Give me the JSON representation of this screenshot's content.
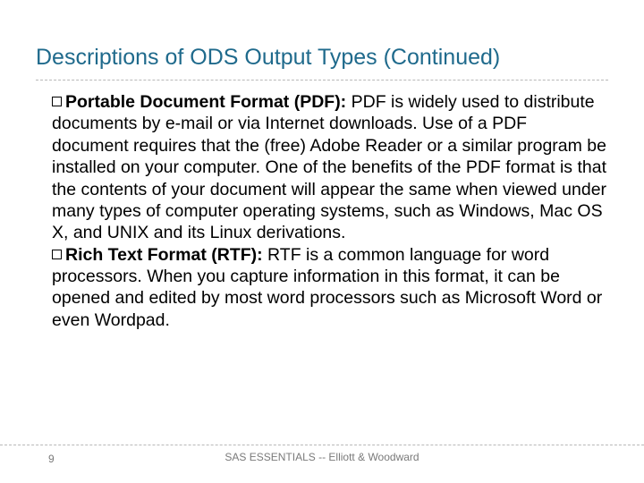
{
  "title": "Descriptions of ODS Output Types (Continued)",
  "items": [
    {
      "heading": "Portable Document Format (PDF):",
      "text": " PDF is widely used to distribute documents by e-mail or via Internet downloads. Use of a PDF document requires that the (free) Adobe Reader or a similar program be installed on your computer. One of the benefits of the PDF format is that the contents of your document will appear the same when viewed under many types of computer operating systems, such as Windows, Mac OS X, and UNIX and its Linux derivations."
    },
    {
      "heading": "Rich Text Format (RTF):",
      "text": " RTF is a common language for word processors. When you capture information in this format, it can be opened and edited by most word processors such as Microsoft Word or even Wordpad."
    }
  ],
  "page_number": "9",
  "footer": "SAS ESSENTIALS -- Elliott & Woodward"
}
